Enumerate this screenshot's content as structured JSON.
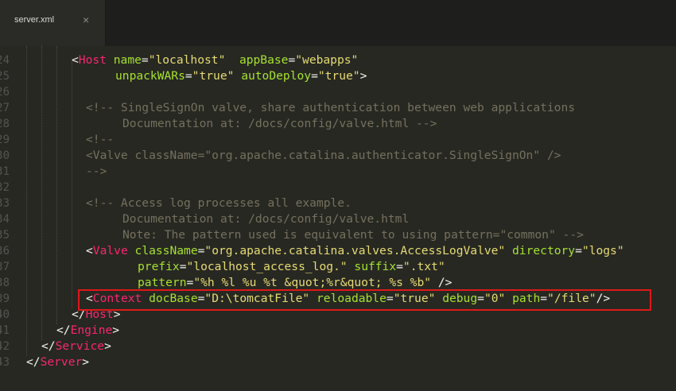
{
  "tab": {
    "title": "server.xml",
    "close_glyph": "×"
  },
  "gutter": [
    "24",
    "25",
    "26",
    "27",
    "28",
    "29",
    "30",
    "31",
    "32",
    "33",
    "34",
    "35",
    "36",
    "37",
    "38",
    "39",
    "40",
    "41",
    "42",
    "43"
  ],
  "code": {
    "l24": {
      "open": "<",
      "tag": "Host",
      "a1": "name",
      "eq1": "=",
      "v1": "\"localhost\"",
      "a2": "appBase",
      "eq2": "=",
      "v2": "\"webapps\""
    },
    "l25": {
      "a1": "unpackWARs",
      "eq1": "=",
      "v1": "\"true\"",
      "a2": "autoDeploy",
      "eq2": "=",
      "v2": "\"true\"",
      "close": ">"
    },
    "l27": {
      "comment": "<!-- SingleSignOn valve, share authentication between web applications"
    },
    "l28": {
      "comment": "Documentation at: /docs/config/valve.html -->"
    },
    "l29": {
      "comment": "<!--"
    },
    "l30": {
      "comment": "<Valve className=\"org.apache.catalina.authenticator.SingleSignOn\" />"
    },
    "l31": {
      "comment": "-->"
    },
    "l33": {
      "comment": "<!-- Access log processes all example."
    },
    "l34": {
      "comment": "Documentation at: /docs/config/valve.html"
    },
    "l35": {
      "comment": "Note: The pattern used is equivalent to using pattern=\"common\" -->"
    },
    "l36": {
      "open": "<",
      "tag": "Valve",
      "a1": "className",
      "eq1": "=",
      "v1": "\"org.apache.catalina.valves.AccessLogValve\"",
      "a2": "directory",
      "eq2": "=",
      "v2": "\"logs\""
    },
    "l37": {
      "a1": "prefix",
      "eq1": "=",
      "v1": "\"localhost_access_log.\"",
      "a2": "suffix",
      "eq2": "=",
      "v2": "\".txt\""
    },
    "l38": {
      "a1": "pattern",
      "eq1": "=",
      "v1": "\"%h %l %u %t &quot;%r&quot; %s %b\"",
      "close": " />"
    },
    "l39": {
      "open": "<",
      "tag": "Context",
      "a1": "docBase",
      "eq1": "=",
      "v1": "\"D:\\tomcatFile\"",
      "a2": "reloadable",
      "eq2": "=",
      "v2": "\"true\"",
      "a3": "debug",
      "eq3": "=",
      "v3": "\"0\"",
      "a4": "path",
      "eq4": "=",
      "v4": "\"/file\"",
      "close": "/>"
    },
    "l40": {
      "open": "</",
      "tag": "Host",
      "close": ">"
    },
    "l41": {
      "open": "</",
      "tag": "Engine",
      "close": ">"
    },
    "l42": {
      "open": "</",
      "tag": "Service",
      "close": ">"
    },
    "l43": {
      "open": "</",
      "tag": "Server",
      "close": ">"
    }
  },
  "colors": {
    "background": "#272822",
    "tag": "#f92672",
    "attribute": "#a6e22e",
    "string": "#e6db74",
    "comment": "#75715e",
    "highlight_box": "#e01818"
  }
}
